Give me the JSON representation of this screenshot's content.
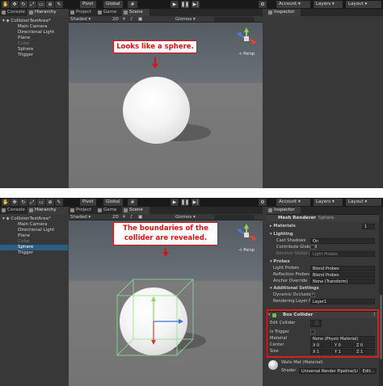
{
  "toolbar": {
    "pivot": "Pivot",
    "global": "Global",
    "account": "Account",
    "layers": "Layers",
    "layout": "Layout",
    "play_icon": "play-icon",
    "pause_icon": "pause-icon",
    "step_icon": "step-icon"
  },
  "tabs": {
    "console": "Console",
    "hierarchy": "Hierarchy",
    "project": "Project",
    "game": "Game",
    "scene": "Scene",
    "inspector": "Inspector"
  },
  "hierarchy": {
    "root": "CollisionTestArea*",
    "items": [
      {
        "label": "Main Camera"
      },
      {
        "label": "Directional Light"
      },
      {
        "label": "Plane"
      },
      {
        "label": "Cube"
      },
      {
        "label": "Sphere"
      },
      {
        "label": "Trigger"
      }
    ]
  },
  "scene_toolbar": {
    "shaded": "Shaded",
    "mode_2d": "2D",
    "gizmos": "Gizmos",
    "persp": "< Persp"
  },
  "callouts": {
    "top": "Looks like a sphere.",
    "bottom_line1": "The boundaries of the",
    "bottom_line2": "collider are revealed."
  },
  "inspector": {
    "mesh_renderer": "Mesh Renderer",
    "sphere_tag": "Sphere",
    "materials": "Materials",
    "materials_count": "1",
    "lighting": "Lighting",
    "cast_shadows": "Cast Shadows",
    "cast_shadows_value": "On",
    "contribute_gi": "Contribute Global Il",
    "receive_gi": "Receive Global Illu",
    "receive_gi_value": "Light Probes",
    "probes": "Probes",
    "light_probes": "Light Probes",
    "light_probes_value": "Blend Probes",
    "reflection_probes": "Reflection Probes",
    "reflection_probes_value": "Blend Probes",
    "anchor_override": "Anchor Override",
    "anchor_override_value": "None (Transform)",
    "additional_settings": "Additional Settings",
    "dynamic_occlusion": "Dynamic Occlusion",
    "rendering_layer_mask": "Rendering Layer M",
    "rendering_layer_value": "Layer1",
    "box_collider": "Box Collider",
    "edit_collider": "Edit Collider",
    "is_trigger": "Is Trigger",
    "material": "Material",
    "material_value": "None (Physic Material)",
    "center": "Center",
    "center_x": "X 0",
    "center_y": "Y 0",
    "center_z": "Z 0",
    "size": "Size",
    "size_x": "X 1",
    "size_y": "Y 1",
    "size_z": "Z 1",
    "walls_mat": "Walls Mat (Material)",
    "shader": "Shader",
    "shader_value": "Universal Render Pipeline/Lit",
    "edit": "Edit..."
  },
  "colors": {
    "callout_red": "#d11111",
    "selection_blue": "#2c5d87",
    "collider_green": "#8fe08f"
  }
}
